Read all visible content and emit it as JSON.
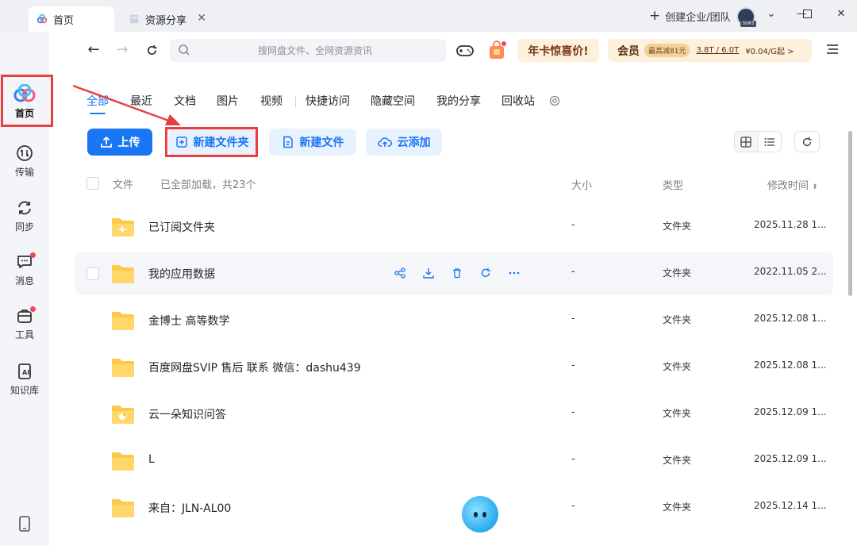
{
  "titlebar": {
    "tabs": [
      {
        "label": "首页",
        "active": true
      },
      {
        "label": "资源分享",
        "active": false
      }
    ],
    "create_org": "创建企业/团队",
    "avatar_badge": "SVIP3"
  },
  "sidebar": {
    "items": [
      {
        "label": "首页",
        "icon": "home-cloud-icon",
        "active": true
      },
      {
        "label": "传输",
        "icon": "transfer-icon"
      },
      {
        "label": "同步",
        "icon": "sync-icon"
      },
      {
        "label": "消息",
        "icon": "message-icon",
        "dot": true
      },
      {
        "label": "工具",
        "icon": "toolbox-icon",
        "dot": true
      },
      {
        "label": "知识库",
        "icon": "knowledge-ai-icon"
      }
    ]
  },
  "toolbar": {
    "search_placeholder": "搜网盘文件、全网资源资讯",
    "promo_label": "年卡惊喜价!",
    "vip_label": "会员",
    "vip_discount": "最高减81元",
    "vip_storage": "3.8T / 6.0T",
    "vip_price": "¥0.04/G起 >"
  },
  "categories": [
    "全部",
    "最近",
    "文档",
    "图片",
    "视频",
    "快捷访问",
    "隐藏空间",
    "我的分享",
    "回收站"
  ],
  "actions": {
    "upload": "上传",
    "new_folder": "新建文件夹",
    "new_file": "新建文件",
    "cloud_add": "云添加"
  },
  "table": {
    "headers": {
      "file": "文件",
      "loaded": "已全部加载，共23个",
      "size": "大小",
      "type": "类型",
      "modified": "修改时间"
    },
    "rows": [
      {
        "name": "已订阅文件夹",
        "size": "-",
        "type": "文件夹",
        "date": "2025.11.28 1...",
        "variant": "subscribed"
      },
      {
        "name": "我的应用数据",
        "size": "-",
        "type": "文件夹",
        "date": "2022.11.05 2...",
        "variant": "plain",
        "hover": true
      },
      {
        "name": "金博士 高等数学",
        "size": "-",
        "type": "文件夹",
        "date": "2025.12.08 1...",
        "variant": "plain"
      },
      {
        "name": "百度网盘SVIP 售后 联系 微信：dashu439",
        "size": "-",
        "type": "文件夹",
        "date": "2025.12.08 1...",
        "variant": "plain"
      },
      {
        "name": "云一朵知识问答",
        "size": "-",
        "type": "文件夹",
        "date": "2025.12.09 1...",
        "variant": "bot"
      },
      {
        "name": "L",
        "size": "-",
        "type": "文件夹",
        "date": "2025.12.09 1...",
        "variant": "plain"
      },
      {
        "name": "来自：JLN-AL00",
        "size": "-",
        "type": "文件夹",
        "date": "2025.12.14 1...",
        "variant": "plain"
      }
    ]
  },
  "colors": {
    "accent": "#1976f5",
    "highlight": "#e84040",
    "folder": "#fcc94b"
  }
}
